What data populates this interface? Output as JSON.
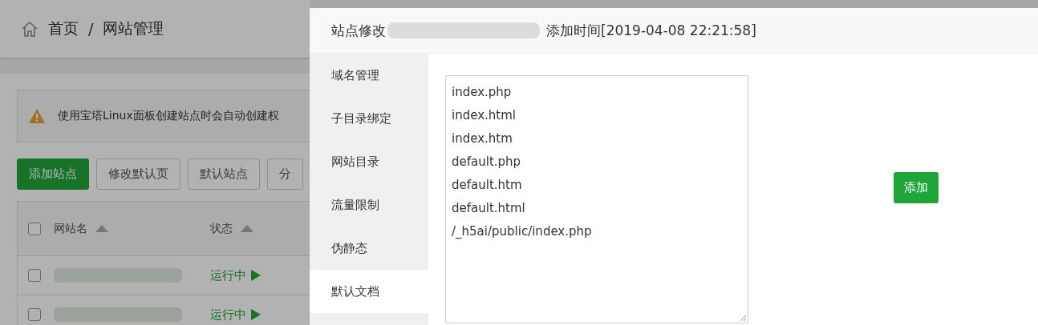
{
  "page": {
    "breadcrumb": [
      "首页",
      "/",
      "网站管理"
    ],
    "notice": "使用宝塔Linux面板创建站点时会自动创建权",
    "buttons": [
      {
        "label": "添加站点",
        "kind": "primary"
      },
      {
        "label": "修改默认页",
        "kind": "default"
      },
      {
        "label": "默认站点",
        "kind": "default"
      },
      {
        "label": "分",
        "kind": "default"
      }
    ],
    "table": {
      "select_all_checked": false,
      "columns": [
        "网站名",
        "状态"
      ],
      "rows": [
        {
          "checked": false,
          "status": "运行中"
        },
        {
          "checked": false,
          "status": "运行中"
        }
      ]
    }
  },
  "modal": {
    "title": "站点修改",
    "added": "添加时间[2019-04-08 22:21:58]",
    "tabs": [
      {
        "label": "域名管理",
        "selected": false
      },
      {
        "label": "子目录绑定",
        "selected": false
      },
      {
        "label": "网站目录",
        "selected": false
      },
      {
        "label": "流量限制",
        "selected": false
      },
      {
        "label": "伪静态",
        "selected": false
      },
      {
        "label": "默认文档",
        "selected": true
      }
    ],
    "documents": [
      "index.php",
      "index.html",
      "index.htm",
      "default.php",
      "default.htm",
      "default.html",
      "/_h5ai/public/index.php"
    ],
    "add_button": "添加"
  }
}
